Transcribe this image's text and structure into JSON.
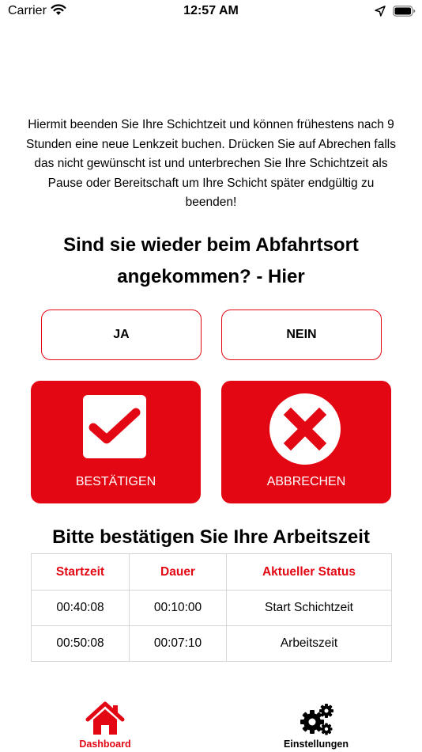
{
  "status_bar": {
    "carrier": "Carrier",
    "time": "12:57 AM",
    "wifi_icon": "wifi-icon",
    "location_icon": "location-arrow-icon",
    "battery_icon": "battery-icon"
  },
  "intro_text": "Hiermit beenden Sie Ihre Schichtzeit und können frühestens nach 9 Stunden eine neue Lenkzeit buchen. Drücken Sie auf Abrechen falls das nicht gewünscht ist und unterbrechen Sie Ihre Schichtzeit als Pause oder Bereitschaft um Ihre Schicht später endgültig zu beenden!",
  "question": "Sind sie wieder beim Abfahrtsort angekommen? - Hier",
  "choices": {
    "yes_label": "JA",
    "no_label": "NEIN"
  },
  "actions": {
    "confirm_label": "BESTÄTIGEN",
    "confirm_icon": "checkbox-check-icon",
    "cancel_label": "ABBRECHEN",
    "cancel_icon": "x-circle-icon"
  },
  "table": {
    "title": "Bitte bestätigen Sie Ihre Arbeitszeit",
    "headers": [
      "Startzeit",
      "Dauer",
      "Aktueller Status"
    ],
    "rows": [
      [
        "00:40:08",
        "00:10:00",
        "Start Schichtzeit"
      ],
      [
        "00:50:08",
        "00:07:10",
        "Arbeitszeit"
      ]
    ]
  },
  "tabbar": {
    "dashboard_label": "Dashboard",
    "dashboard_icon": "home-icon",
    "settings_label": "Einstellungen",
    "settings_icon": "gears-icon"
  },
  "colors": {
    "accent": "#e30613",
    "border": "#d6d6d6",
    "text": "#000000"
  }
}
